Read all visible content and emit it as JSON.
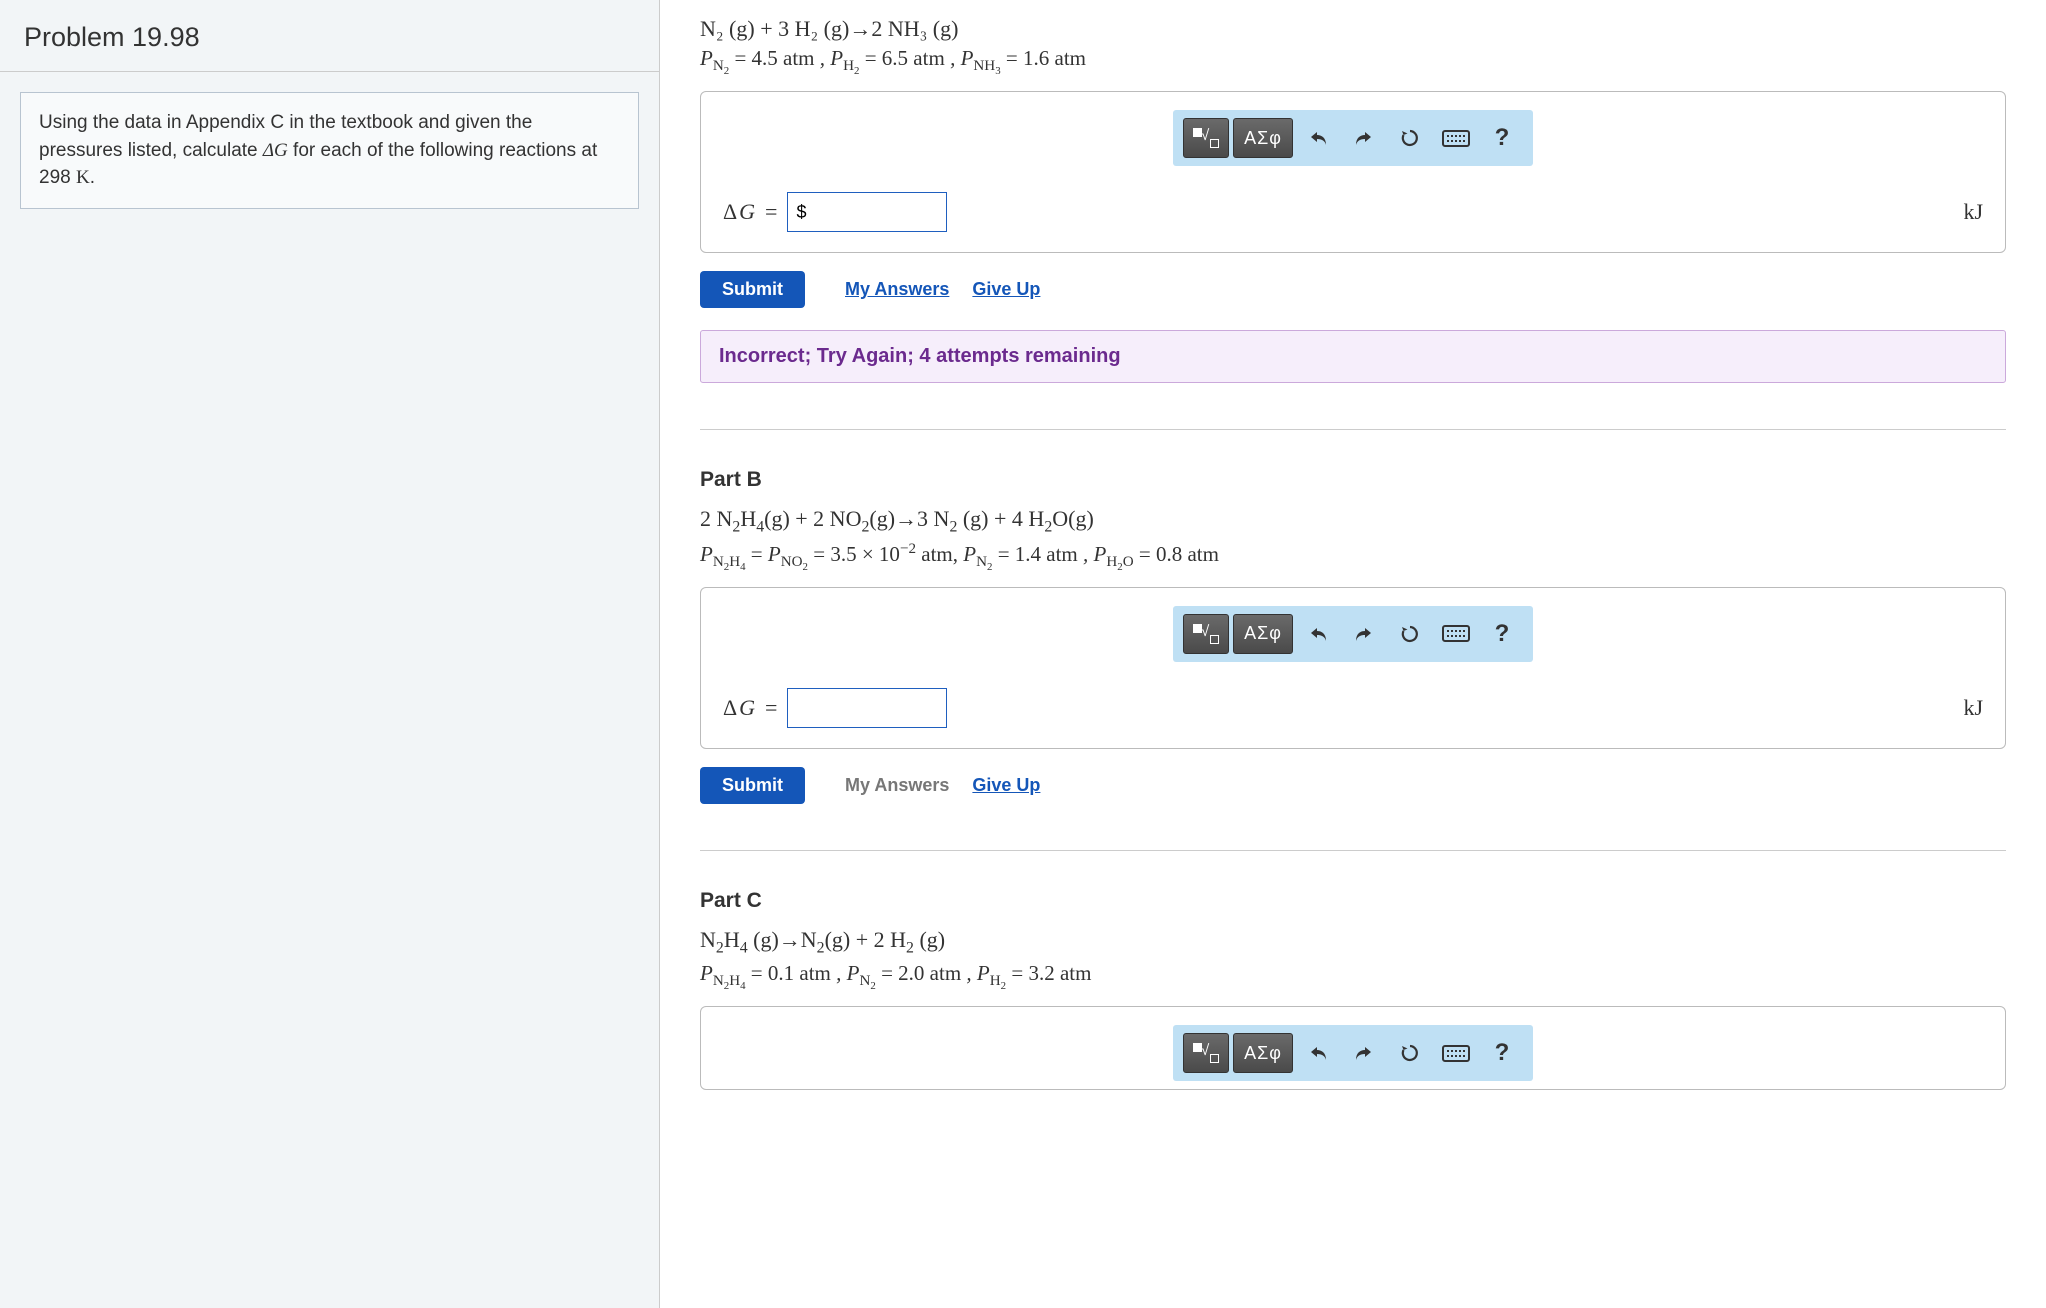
{
  "problem": {
    "title": "Problem 19.98",
    "instructions_1": "Using the data in Appendix C in the textbook and given the pressures listed, calculate ",
    "instructions_dg": "ΔG",
    "instructions_2": " for each of the following reactions at 298 ",
    "instructions_unit": "K",
    "instructions_3": "."
  },
  "toolbar": {
    "greek": "ΑΣφ",
    "help": "?"
  },
  "labels": {
    "dg": "ΔG",
    "equals": "=",
    "unit": "kJ",
    "submit": "Submit",
    "my_answers": "My Answers",
    "give_up": "Give Up"
  },
  "partA": {
    "reaction": "N₂ (g) + 3 H₂ (g)→2 NH₃ (g)",
    "p_line_html": "P<sub>N₂</sub> = 4.5 atm , P<sub>H₂</sub> = 6.5 atm , P<sub>NH₃</sub> = 1.6 atm",
    "input_value": "$",
    "my_answers_active": true,
    "feedback": "Incorrect; Try Again; 4 attempts remaining"
  },
  "partB": {
    "title": "Part B",
    "reaction": "2 N₂H₄(g) + 2 NO₂(g)→3 N₂ (g) + 4 H₂O(g)",
    "p_line_html": "P<sub>N₂H₄</sub> = P<sub>NO₂</sub> = 3.5 × 10⁻² atm, P<sub>N₂</sub> = 1.4 atm , P<sub>H₂O</sub> = 0.8 atm",
    "input_value": "",
    "my_answers_active": false
  },
  "partC": {
    "title": "Part C",
    "reaction": "N₂H₄ (g)→N₂(g) + 2 H₂ (g)",
    "p_line_html": "P<sub>N₂H₄</sub> = 0.1 atm , P<sub>N₂</sub> = 2.0 atm , P<sub>H₂</sub> = 3.2 atm"
  }
}
